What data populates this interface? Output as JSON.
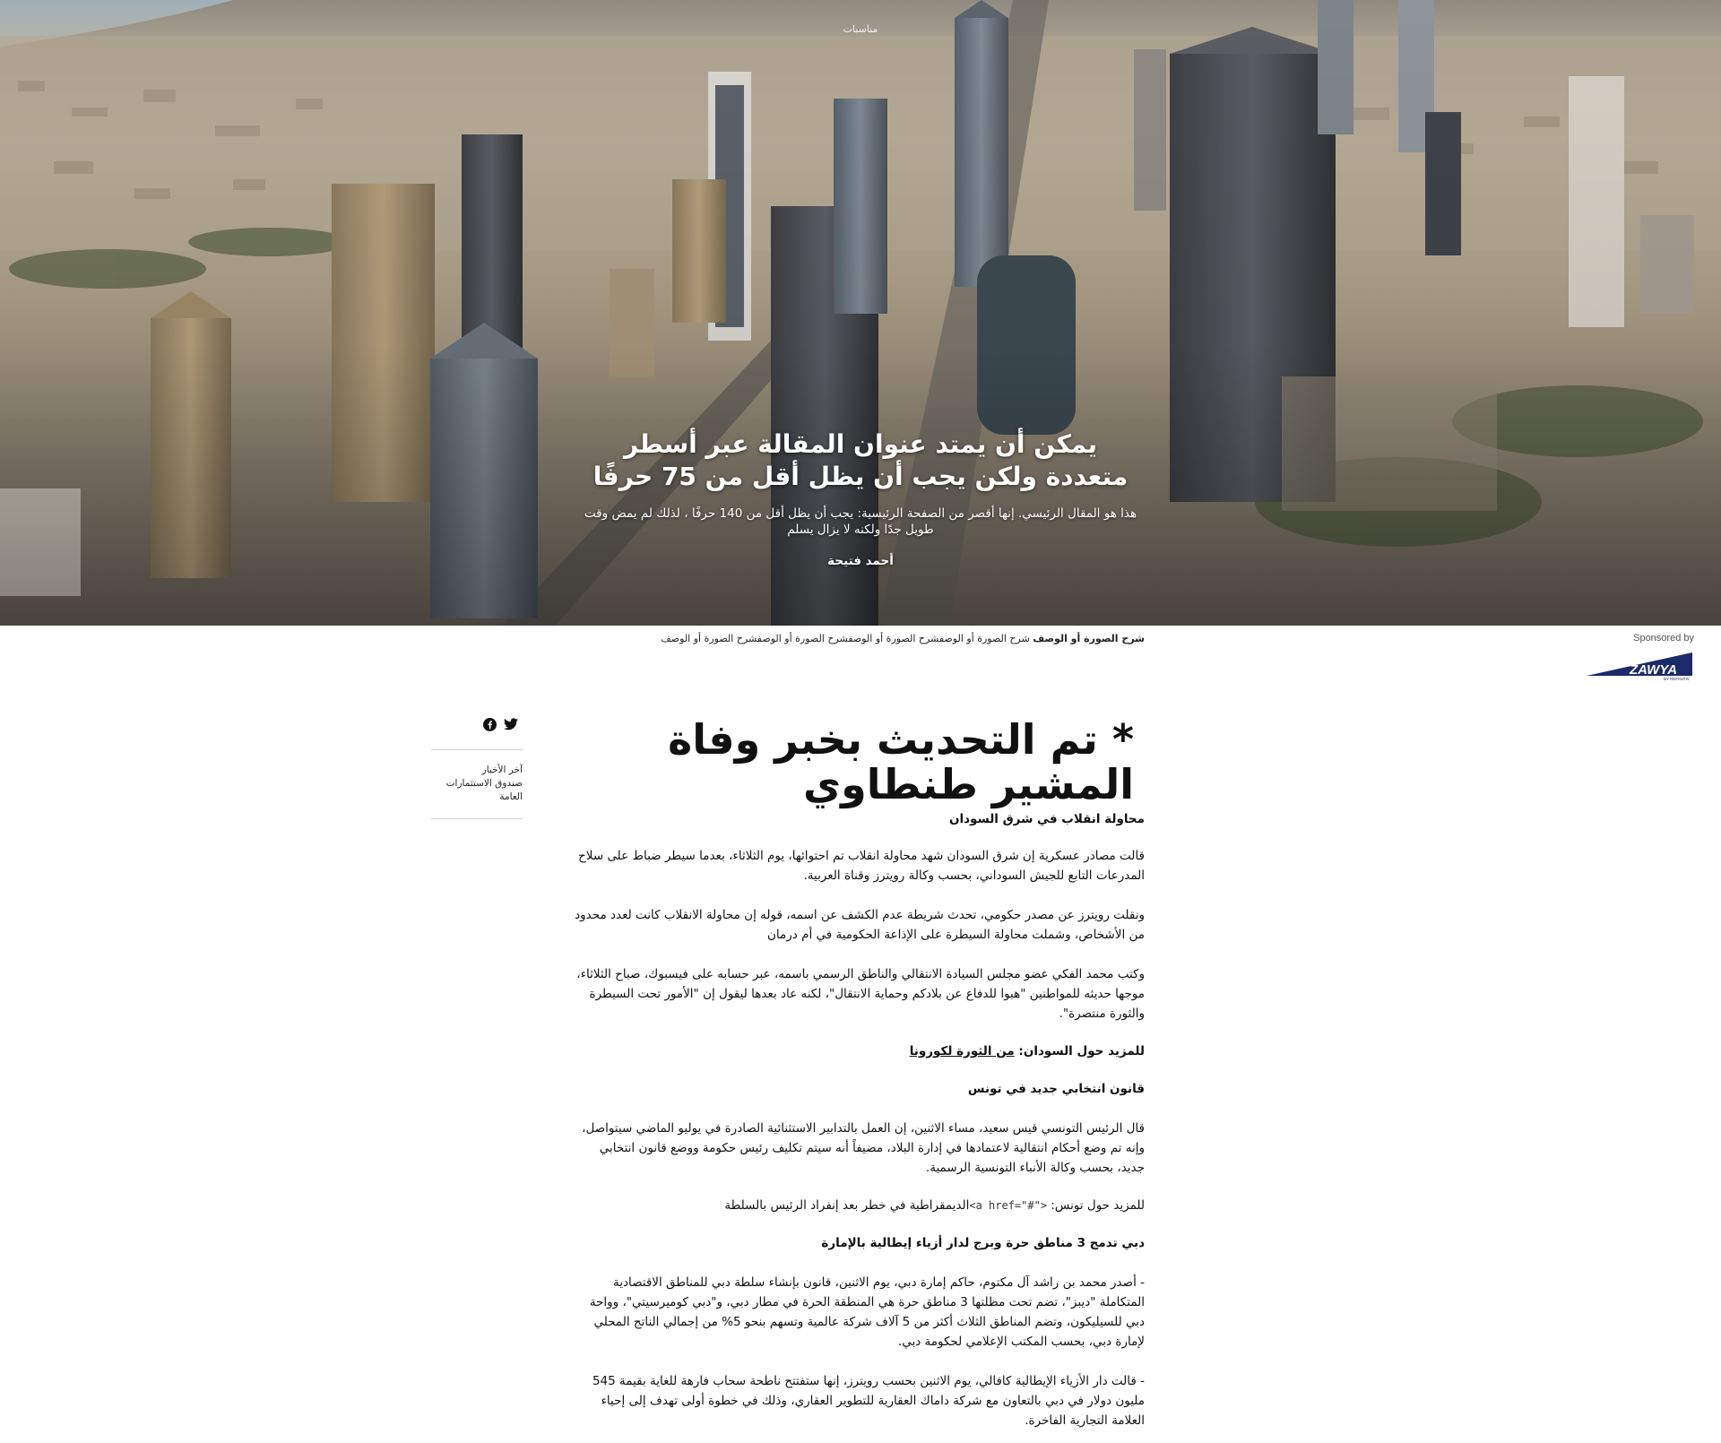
{
  "hero": {
    "eyebrow": "مناسبات",
    "title": "يمكن أن يمتد عنوان المقالة عبر أسطر متعددة ولكن يجب أن يظل أقل من 75 حرفًا",
    "dek": "هذا هو المقال الرئيسي. إنها أقصر من الصفحة الرئيسية: يجب أن يظل أقل من 140 حرفًا ، لذلك لم يمض وقت طويل جدًا ولكنه لا يزال يسلم",
    "author": "أحمد فتيحة"
  },
  "caption": {
    "bold": "شرح الصورة أو الوصف",
    "rest": " شرح الصورة أو الوصفشرح الصورة أو الوصفشرح الصورة أو الوصفشرح الصورة أو الوصف"
  },
  "sponsor": {
    "label": "Sponsored by",
    "logo_text": "ZAWYA",
    "logo_sub": "BY REFINITIV"
  },
  "sidebar": {
    "share_icons": [
      "twitter-icon",
      "facebook-icon"
    ],
    "links": [
      "آخر الأخبار",
      "صندوق الاستثمارات العامة"
    ]
  },
  "article": {
    "title": "* تم التحديث بخبر وفاة المشير طنطاوي",
    "subtitle": "محاولة انقلاب في شرق السودان",
    "p1": "قالت مصادر عسكرية إن شرق السودان شهد محاولة انقلاب تم احتوائها، يوم الثلاثاء، بعدما سيطر ضباط على سلاح المدرعات التابع للجيش السوداني، بحسب وكالة رويترز وقناة العربية.",
    "p2": "ونقلت رويترز عن مصدر حكومي، تحدث شريطة عدم الكشف عن اسمه، قوله إن محاولة الانقلاب كانت لعدد محدود من الأشخاص، وشملت محاولة السيطرة على الإذاعة الحكومية في أم درمان",
    "p3": "وكتب محمد الفكي عضو مجلس السيادة الانتقالي والناطق الرسمي باسمه، عبر حسابه على فيسبوك، صباح الثلاثاء، موجها حديثه للمواطنين \"هبوا للدفاع عن بلادكم وحماية الانتقال\"، لكنه عاد بعدها ليقول إن \"الأمور تحت السيطرة والثورة منتصرة\".",
    "more1_label": "للمزيد حول السودان: ",
    "more1_link": "من الثورة لكورونا",
    "h2": "قانون انتخابي جديد في تونس",
    "p4": "قال الرئيس التونسي قيس سعيد، مساء الاثنين، إن العمل بالتدابير الاستثنائية الصادرة في يوليو الماضي سيتواصل، وإنه تم وضع أحكام انتقالية لاعتمادها في إدارة البلاد، مضيفاً أنه سيتم تكليف رئيس حكومة ووضع قانون انتخابي جديد، بحسب وكالة الأنباء التونسية الرسمية.",
    "more2_label": "للمزيد حول تونس: ",
    "more2_code": "<a href=\"#\">",
    "more2_text": "الديمقراطية في خطر بعد إنفراد الرئيس بالسلطة",
    "h3": "دبي تدمج 3 مناطق حرة وبرج لدار أزياء إيطالية بالإمارة",
    "p5": "- أصدر محمد بن راشد آل مكتوم، حاكم إمارة دبي، يوم الاثنين، قانون بإنشاء سلطة دبي للمناطق الاقتصادية المتكاملة \"ديبز\"، تضم تحت مظلتها 3 مناطق حرة هي المنطقة الحرة في مطار دبي، و\"دبي كوميرسيتي\"، وواحة دبي للسيليكون، وتضم المناطق الثلاث أكثر من 5 آلاف شركة عالمية وتسهم بنحو 5% من إجمالي الناتج المحلي لإمارة دبي، بحسب المكتب الإعلامي لحكومة دبي.",
    "p6": "- قالت دار الأزياء الإيطالية كافالي، يوم الاثنين بحسب رويترز، إنها ستفتتح ناطحة سحاب فارهة للغاية بقيمة 545 مليون دولار في دبي بالتعاون مع شركة داماك العقارية للتطوير العقاري، وذلك في خطوة أولى تهدف إلى إحياء العلامة التجارية الفاخرة."
  },
  "colors": {
    "text": "#111111",
    "zawya_navy": "#1b2a6b",
    "rule": "#cfcfcf"
  }
}
